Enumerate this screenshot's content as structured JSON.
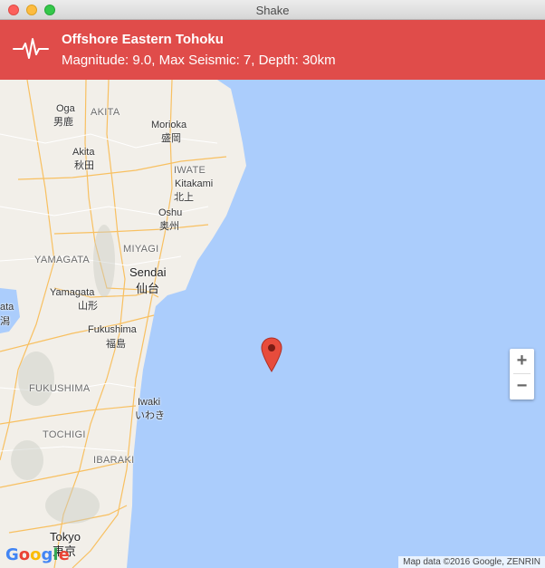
{
  "window": {
    "title": "Shake"
  },
  "banner": {
    "title": "Offshore Eastern Tohoku",
    "details": "Magnitude: 9.0, Max Seismic: 7, Depth: 30km",
    "icon": "seismograph-icon",
    "color": "#e04c4a"
  },
  "map": {
    "labels": {
      "akita_pref": "AKITA",
      "oga": "Oga",
      "oga_jp": "男鹿",
      "morioka": "Morioka",
      "morioka_jp": "盛岡",
      "akita": "Akita",
      "akita_jp": "秋田",
      "iwate_pref": "IWATE",
      "kitakami": "Kitakami",
      "kitakami_jp": "北上",
      "oshu": "Oshu",
      "oshu_jp": "奥州",
      "miyagi_pref": "MIYAGI",
      "yamagata_pref": "YAMAGATA",
      "sendai": "Sendai",
      "sendai_jp": "仙台",
      "yamagata": "Yamagata",
      "yamagata_jp": "山形",
      "fukushima": "Fukushima",
      "fukushima_jp": "福島",
      "fukushima_pref": "FUKUSHIMA",
      "iwaki": "Iwaki",
      "iwaki_jp": "いわき",
      "tochigi_pref": "TOCHIGI",
      "ibaraki_pref": "IBARAKI",
      "tokyo": "Tokyo",
      "tokyo_jp": "東京",
      "left_edge_1": "ata",
      "left_edge_2": "潟"
    },
    "zoom_in": "+",
    "zoom_out": "−",
    "attribution": "Map data ©2016 Google, ZENRIN",
    "logo": "Google",
    "marker_icon": "map-pin-icon",
    "water_color": "#abcdfc",
    "land_color": "#f2efe9"
  }
}
